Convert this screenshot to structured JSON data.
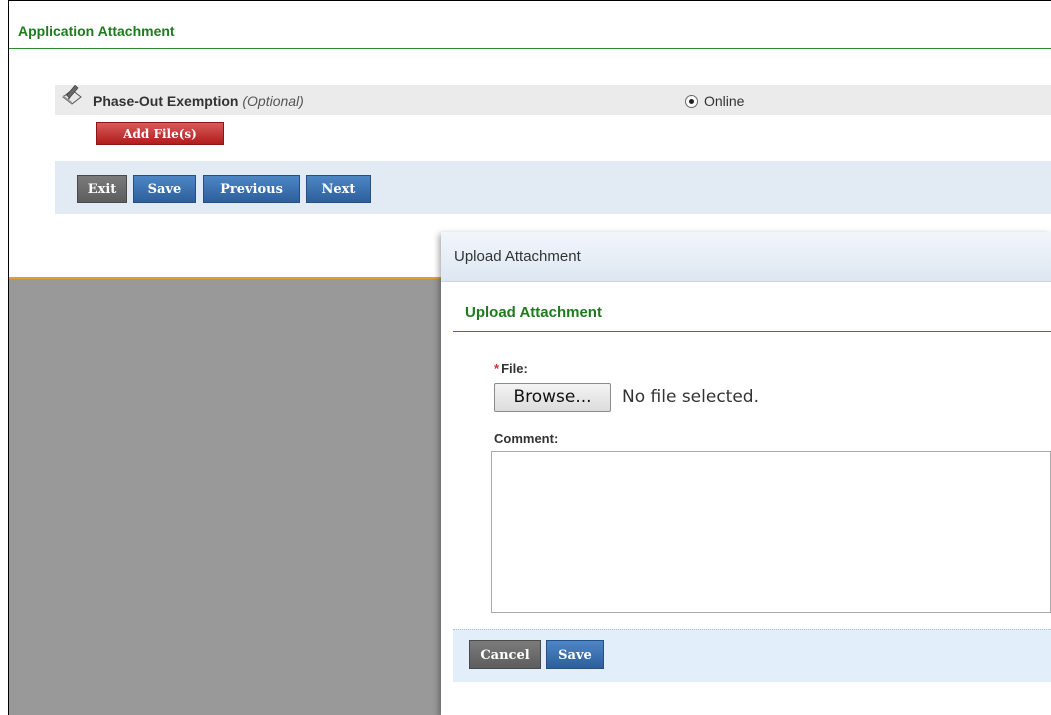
{
  "page": {
    "section_title": "Application Attachment",
    "document": {
      "name": "Phase-Out Exemption",
      "optional_tag": "(Optional)",
      "submission_option": "Online",
      "add_file_label": "Add File(s)"
    },
    "nav_buttons": {
      "exit": "Exit",
      "save": "Save",
      "previous": "Previous",
      "next": "Next"
    }
  },
  "dialog": {
    "title": "Upload Attachment",
    "section_title": "Upload Attachment",
    "file_label": "File:",
    "required_mark": "*",
    "browse_label": "Browse...",
    "file_status": "No file selected.",
    "comment_label": "Comment:",
    "comment_value": "",
    "cancel_label": "Cancel",
    "save_label": "Save"
  },
  "icons": {
    "document_icon": "pen-on-paper-icon",
    "radio_selected": "radio-selected-icon"
  },
  "colors": {
    "section_green": "#1e7a1e",
    "add_file_red": "#b21c1c",
    "button_blue": "#2d5f9b",
    "button_grey": "#5d5d5d",
    "overlay_grey": "#999999",
    "accent_orange": "#e0a030"
  }
}
